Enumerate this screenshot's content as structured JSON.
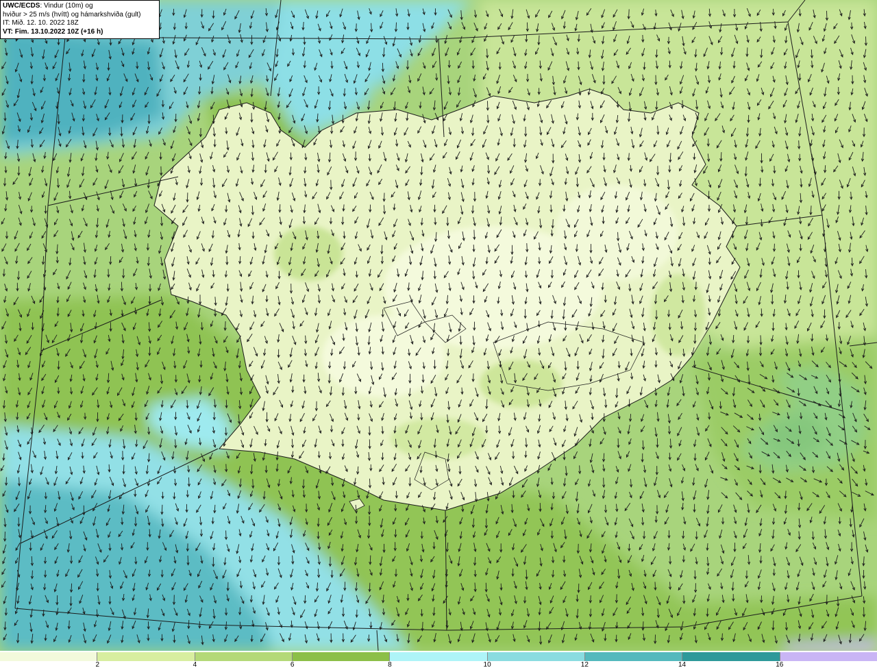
{
  "header": {
    "model": "UWC/ECDS",
    "title_rest": ": Vindur (10m) og",
    "line2": "hviður > 25 m/s (hvítt) og hámarkshviða (gult)",
    "line3": "IT: Mið. 12. 10. 2022 18Z",
    "line4": "VT: Fim. 13.10.2022 10Z (+16 h)"
  },
  "legend": {
    "colors": [
      "#f3fadc",
      "#d8eea0",
      "#b4d978",
      "#8cbf48",
      "#aef4f8",
      "#8adce0",
      "#54b9bd",
      "#2e999a",
      "#c9b5f5"
    ],
    "ticks": [
      "2",
      "4",
      "6",
      "8",
      "10",
      "12",
      "14",
      "16"
    ]
  },
  "map": {
    "sea_color": "#a4d17a",
    "land_color": "#e6f2c2",
    "deep_color": "#45a8b8"
  }
}
